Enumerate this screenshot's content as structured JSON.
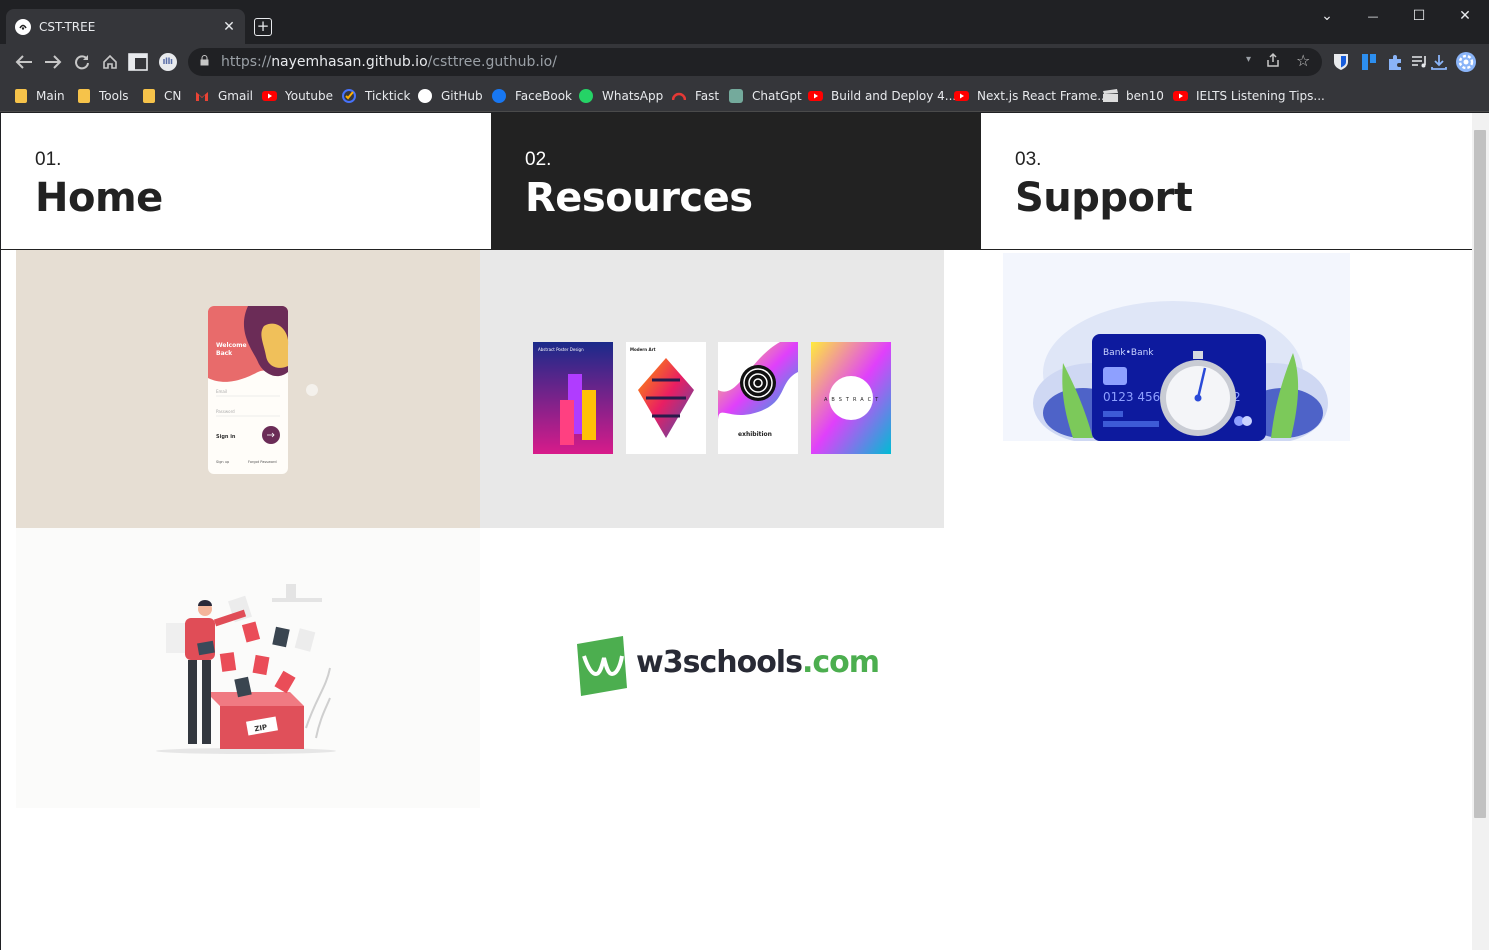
{
  "tab": {
    "title": "CST-TREE",
    "close": "✕",
    "new_tab": "+"
  },
  "window_controls": {
    "dropdown": "⌄",
    "minimize": "—",
    "maximize": "☐",
    "close": "✕"
  },
  "address": {
    "scheme": "https://",
    "host": "nayemhasan.github.io",
    "path": "/csttree.guthub.io/"
  },
  "bookmarks": [
    {
      "label": "Main",
      "icon": "folder-icon",
      "color": "#f6c34a"
    },
    {
      "label": "Tools",
      "icon": "folder-icon",
      "color": "#f6c34a"
    },
    {
      "label": "CN",
      "icon": "folder-icon",
      "color": "#f6c34a"
    },
    {
      "label": "Gmail",
      "icon": "gmail-icon",
      "color": "#ea4335"
    },
    {
      "label": "Youtube",
      "icon": "youtube-icon",
      "color": "#ff0000"
    },
    {
      "label": "Ticktick",
      "icon": "ticktick-icon",
      "color": "#4772fa"
    },
    {
      "label": "GitHub",
      "icon": "github-icon",
      "color": "#ffffff"
    },
    {
      "label": "FaceBook",
      "icon": "facebook-icon",
      "color": "#1877f2"
    },
    {
      "label": "WhatsApp",
      "icon": "whatsapp-icon",
      "color": "#25d366"
    },
    {
      "label": "Fast",
      "icon": "fast-icon",
      "color": "#e53935"
    },
    {
      "label": "ChatGpt",
      "icon": "chatgpt-icon",
      "color": "#74aa9c"
    },
    {
      "label": "Build and Deploy 4...",
      "icon": "youtube-icon",
      "color": "#ff0000"
    },
    {
      "label": "Next.js React Frame...",
      "icon": "youtube-icon",
      "color": "#ff0000"
    },
    {
      "label": "ben10",
      "icon": "clapper-icon",
      "color": "#888888"
    },
    {
      "label": "IELTS Listening Tips...",
      "icon": "youtube-icon",
      "color": "#ff0000"
    }
  ],
  "nav": [
    {
      "num": "01.",
      "label": "Home",
      "active": false
    },
    {
      "num": "02.",
      "label": "Resources",
      "active": true
    },
    {
      "num": "03.",
      "label": "Support",
      "active": false
    }
  ],
  "cards": [
    {
      "name": "mobile-login-ui",
      "text": [
        "Welcome",
        "Back",
        "Email",
        "Password",
        "Sign in",
        "Sign up",
        "Forgot Password"
      ]
    },
    {
      "name": "abstract-posters",
      "text": [
        "Abstract Poster Design",
        "Modern Art",
        "exhibition",
        "ABSTRACT"
      ]
    },
    {
      "name": "bank-card-timer",
      "text": [
        "Bank•Bank",
        "0123 456",
        "2"
      ]
    },
    {
      "name": "zip-files-illustration",
      "text": [
        "ZIP"
      ]
    },
    {
      "name": "w3schools-logo",
      "text": [
        "w3schools",
        ".com"
      ]
    }
  ],
  "colors": {
    "active_nav_bg": "#222222",
    "w3_green": "#4cae4f",
    "browser_dark": "#202124",
    "toolbar": "#35363a"
  }
}
